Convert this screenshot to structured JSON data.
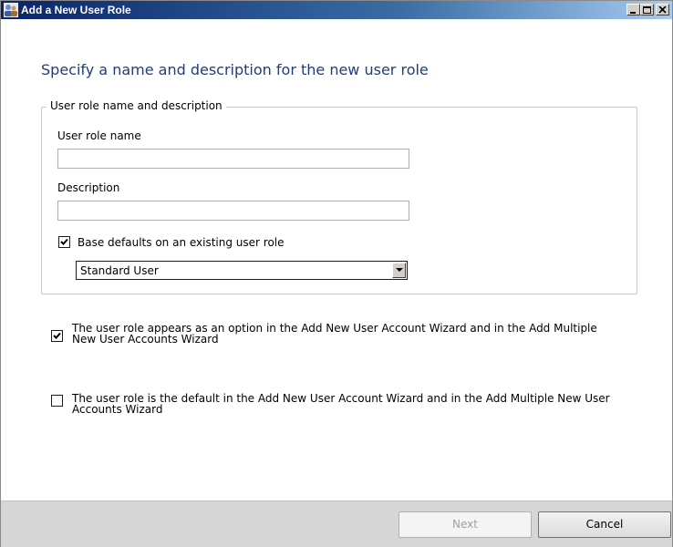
{
  "window": {
    "title": "Add a New User Role",
    "icon": "users-icon"
  },
  "page": {
    "heading": "Specify a name and description for the new user role"
  },
  "group": {
    "legend": "User role name and description",
    "name_label": "User role name",
    "name_value": "",
    "description_label": "Description",
    "description_value": "",
    "base_defaults_label": "Base defaults on an existing user role",
    "base_defaults_checked": true,
    "role_select_value": "Standard User"
  },
  "options": {
    "appears_as_option": {
      "checked": true,
      "line1": "The user role appears as an option in the Add New User Account Wizard and in the Add Multiple",
      "line2": "New User Accounts Wizard"
    },
    "is_default": {
      "checked": false,
      "line1": "The user role is the default in the Add New User Account Wizard and in the Add Multiple New User",
      "line2": "Accounts Wizard"
    }
  },
  "footer": {
    "next_label": "Next",
    "cancel_label": "Cancel"
  }
}
